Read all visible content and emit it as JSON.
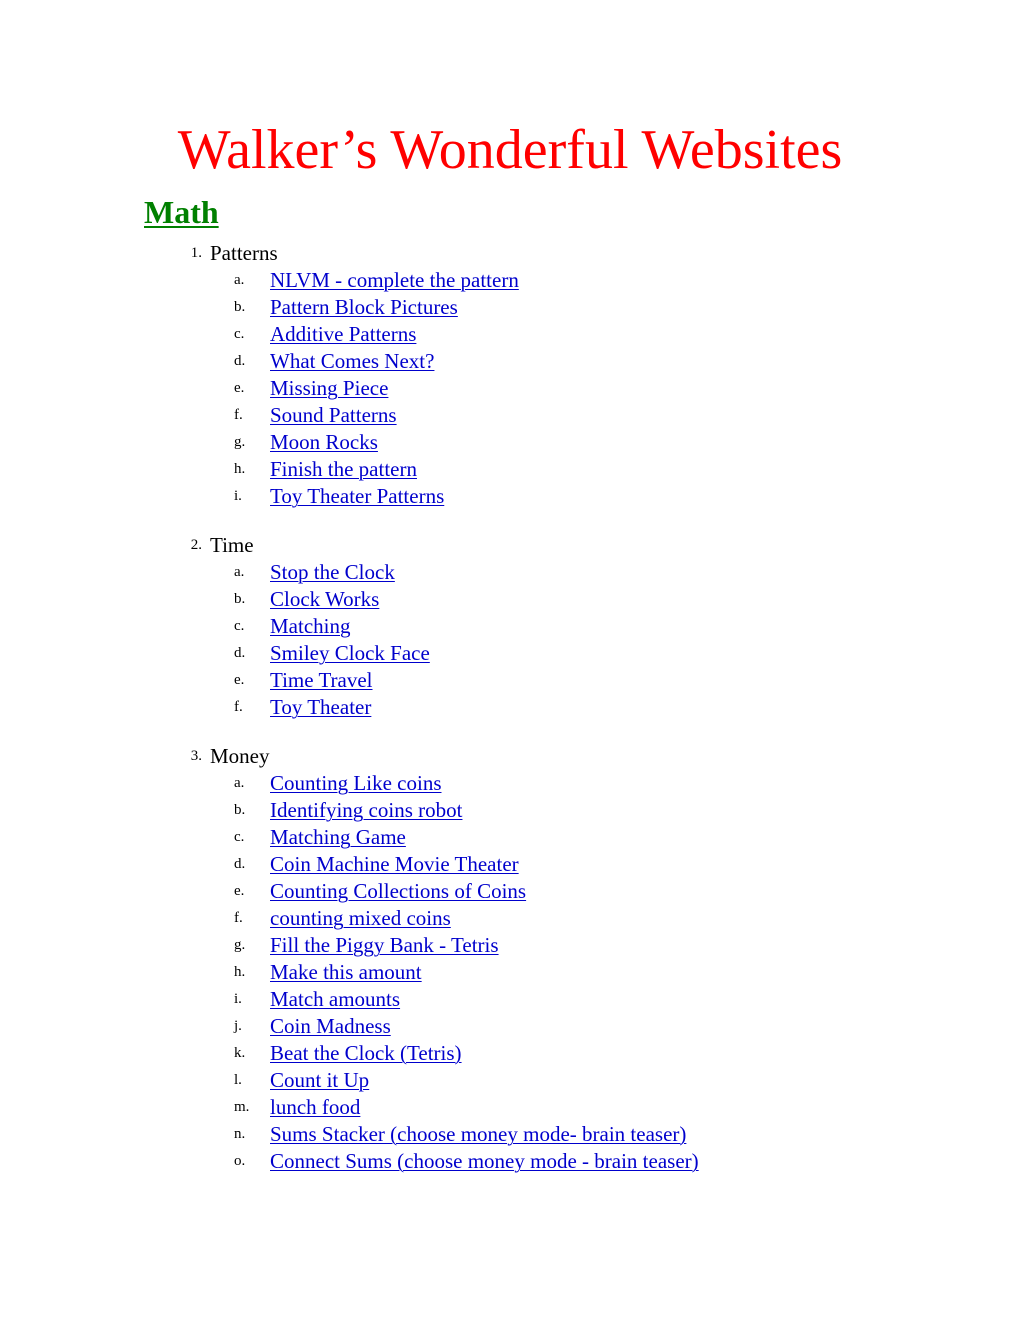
{
  "document": {
    "title": "Walker’s Wonderful Websites",
    "title_color": "#FF0000",
    "heading": "Math",
    "heading_color": "#008000",
    "link_color": "#0000CC",
    "background_color": "#FFFFFF"
  },
  "outline": [
    {
      "marker": "1.",
      "label": "Patterns",
      "items": [
        {
          "marker": "a.",
          "label": "NLVM - complete the pattern"
        },
        {
          "marker": "b.",
          "label": "Pattern Block Pictures"
        },
        {
          "marker": "c.",
          "label": "Additive Patterns"
        },
        {
          "marker": "d.",
          "label": "What Comes Next?"
        },
        {
          "marker": "e.",
          "label": "Missing Piece"
        },
        {
          "marker": "f.",
          "label": "Sound Patterns"
        },
        {
          "marker": "g.",
          "label": "Moon Rocks"
        },
        {
          "marker": "h.",
          "label": "Finish the pattern"
        },
        {
          "marker": "i.",
          "label": "Toy Theater Patterns"
        }
      ]
    },
    {
      "marker": "2.",
      "label": "Time",
      "items": [
        {
          "marker": "a.",
          "label": "Stop the Clock"
        },
        {
          "marker": "b.",
          "label": "Clock Works"
        },
        {
          "marker": "c.",
          "label": "Matching"
        },
        {
          "marker": "d.",
          "label": "Smiley Clock Face"
        },
        {
          "marker": "e.",
          "label": "Time Travel"
        },
        {
          "marker": "f.",
          "label": "Toy Theater"
        }
      ]
    },
    {
      "marker": "3.",
      "label": "Money",
      "items": [
        {
          "marker": "a.",
          "label": "Counting Like coins"
        },
        {
          "marker": "b.",
          "label": "Identifying coins robot"
        },
        {
          "marker": "c.",
          "label": "Matching Game"
        },
        {
          "marker": "d.",
          "label": "Coin Machine Movie Theater"
        },
        {
          "marker": "e.",
          "label": "Counting Collections of Coins"
        },
        {
          "marker": "f.",
          "label": "counting mixed coins"
        },
        {
          "marker": "g.",
          "label": "Fill the Piggy Bank - Tetris"
        },
        {
          "marker": "h.",
          "label": "Make this amount"
        },
        {
          "marker": "i.",
          "label": "Match amounts"
        },
        {
          "marker": "j.",
          "label": "Coin Madness"
        },
        {
          "marker": "k.",
          "label": "Beat the Clock (Tetris)"
        },
        {
          "marker": "l.",
          "label": "Count it Up"
        },
        {
          "marker": "m.",
          "label": "lunch food"
        },
        {
          "marker": "n.",
          "label": "Sums Stacker (choose money mode- brain teaser)"
        },
        {
          "marker": "o.",
          "label": "Connect Sums (choose money mode - brain teaser)"
        }
      ]
    }
  ]
}
